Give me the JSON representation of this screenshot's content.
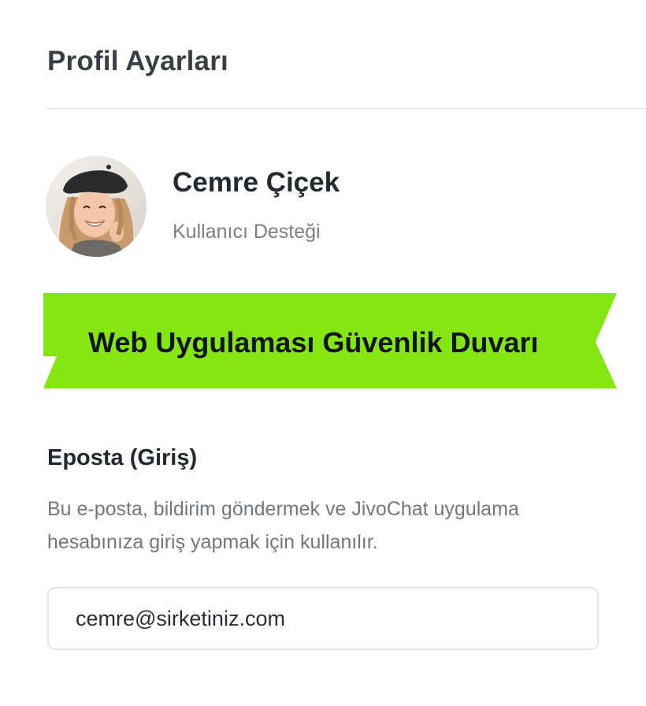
{
  "header": {
    "title": "Profil Ayarları"
  },
  "profile": {
    "name": "Cemre Çiçek",
    "role": "Kullanıcı Desteği",
    "avatar_icon": "user-photo"
  },
  "banner": {
    "text": "Web Uygulaması Güvenlik Duvarı",
    "color": "#86e613"
  },
  "email_section": {
    "label": "Eposta (Giriş)",
    "help_text": "Bu e-posta, bildirim göndermek ve JivoChat uygulama hesabınıza giriş yapmak için kullanılır.",
    "value": "cemre@sirketiniz.com"
  }
}
